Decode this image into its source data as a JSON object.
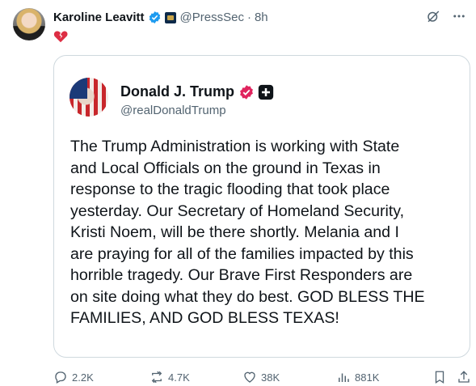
{
  "post": {
    "author_name": "Karoline Leavitt",
    "handle": "@PressSec",
    "separator": "·",
    "time": "8h",
    "emoji": "💔"
  },
  "quoted_post": {
    "author_name": "Donald J. Trump",
    "handle": "@realDonaldTrump",
    "text": "The Trump Administration is working with State\nand Local Officials on the ground in Texas in\nresponse to the tragic flooding that took place\nyesterday. Our Secretary of Homeland Security,\nKristi Noem, will be there shortly. Melania and I\nare praying for all of the families impacted by this\nhorrible tragedy. Our Brave First Responders are\non site doing what they do best. GOD BLESS THE\nFAMILIES, AND GOD BLESS TEXAS!"
  },
  "actions": {
    "replies": "2.2K",
    "reposts": "4.7K",
    "likes": "38K",
    "views": "881K"
  },
  "icons": [
    "verified-badge-icon",
    "affiliate-flag-icon",
    "grok-icon",
    "more-icon",
    "broken-heart-icon",
    "truth-social-icon",
    "reply-icon",
    "repost-icon",
    "like-icon",
    "views-icon",
    "bookmark-icon",
    "share-icon"
  ],
  "colors": {
    "verified_blue": "#1d9bf0",
    "verified_pink": "#e0245e",
    "secondary_text": "#536471",
    "border": "#cfd9de"
  }
}
